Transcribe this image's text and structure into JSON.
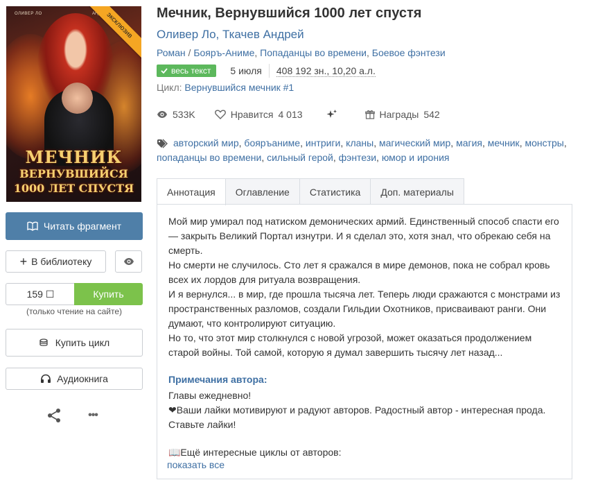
{
  "cover": {
    "author_left": "ОЛИВЕР ЛО",
    "author_right": "АНДР",
    "title_line1": "МЕЧНИК",
    "title_line2": "ВЕРНУВШИЙСЯ",
    "title_line3": "1000 ЛЕТ СПУСТЯ",
    "ribbon": "эксклюзив"
  },
  "sidebar": {
    "read_fragment": "Читать фрагмент",
    "to_library": "В библиотеку",
    "price": "159 ☐",
    "buy": "Купить",
    "only_read": "(только чтение на сайте)",
    "buy_cycle": "Купить цикл",
    "audiobook": "Аудиокнига"
  },
  "book": {
    "title": "Мечник, Вернувшийся 1000 лет спустя",
    "authors": [
      "Оливер Ло",
      "Ткачев Андрей"
    ],
    "genres": [
      "Роман",
      "Бояръ-Аниме",
      "Попаданцы во времени",
      "Боевое фэнтези"
    ],
    "status_badge": "весь текст",
    "date": "5 июля",
    "size": "408 192 зн., 10,20 а.л.",
    "cycle_label": "Цикл:",
    "cycle_name": "Вернувшийся мечник #1",
    "views": "533K",
    "likes_label": "Нравится",
    "likes": "4 013",
    "awards_label": "Награды",
    "awards": "542",
    "tags": [
      "авторский мир",
      "бояръаниме",
      "интриги",
      "кланы",
      "магический мир",
      "магия",
      "мечник",
      "монстры",
      "попаданцы во времени",
      "сильный герой",
      "фэнтези",
      "юмор и ирония"
    ]
  },
  "tabs": [
    "Аннотация",
    "Оглавление",
    "Статистика",
    "Доп. материалы"
  ],
  "annotation": {
    "p1": "Мой мир умирал под натиском демонических армий. Единственный способ спасти его — закрыть Великий Портал изнутри. И я сделал это, хотя знал, что обрекаю себя на смерть.",
    "p2": "Но смерти не случилось. Сто лет я сражался в мире демонов, пока не собрал кровь всех их лордов для ритуала возвращения.",
    "p3": "И я вернулся... в мир, где прошла тысяча лет. Теперь люди сражаются с монстрами из пространственных разломов, создали Гильдии Охотников, присваивают ранги. Они думают, что контролируют ситуацию.",
    "p4": "Но то, что этот мир столкнулся с новой угрозой, может оказаться продолжением старой войны. Той самой, которую я думал завершить тысячу лет назад..."
  },
  "notes": {
    "title": "Примечания автора:",
    "line1": "Главы ежедневно!",
    "line2": "❤Ваши лайки мотивируют и радуют авторов. Радостный автор - интересная прода. Ставьте лайки!",
    "more_cycles": "📖Ещё интересные циклы от авторов:",
    "show_all": "показать все"
  }
}
